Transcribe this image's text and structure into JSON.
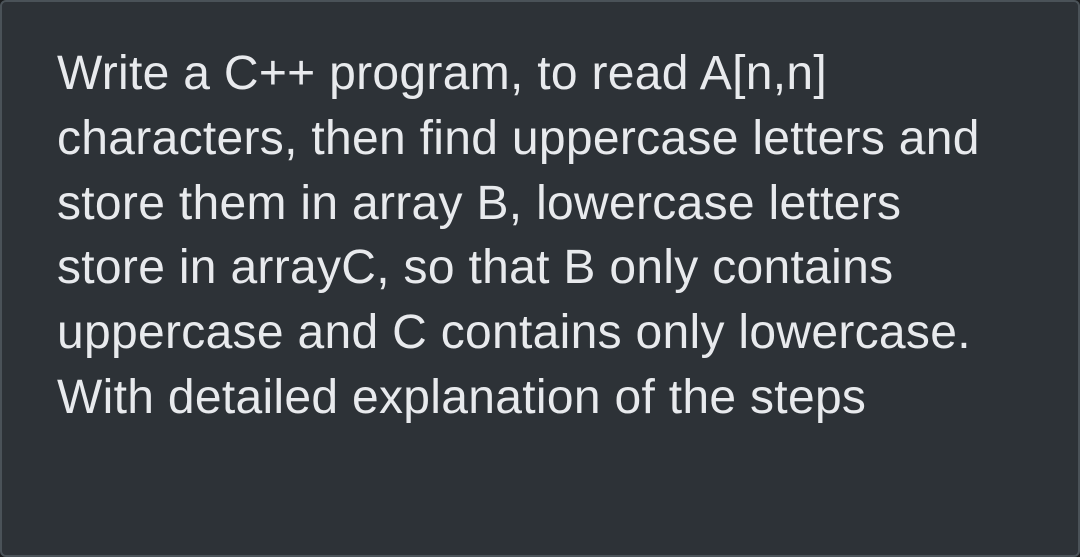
{
  "question": {
    "text": "Write a C++ program, to read A[n,n] characters, then find uppercase letters and store them in array B, lowercase letters store in arrayC, so that B only contains uppercase and C contains only lowercase.  With detailed explanation of the steps"
  }
}
